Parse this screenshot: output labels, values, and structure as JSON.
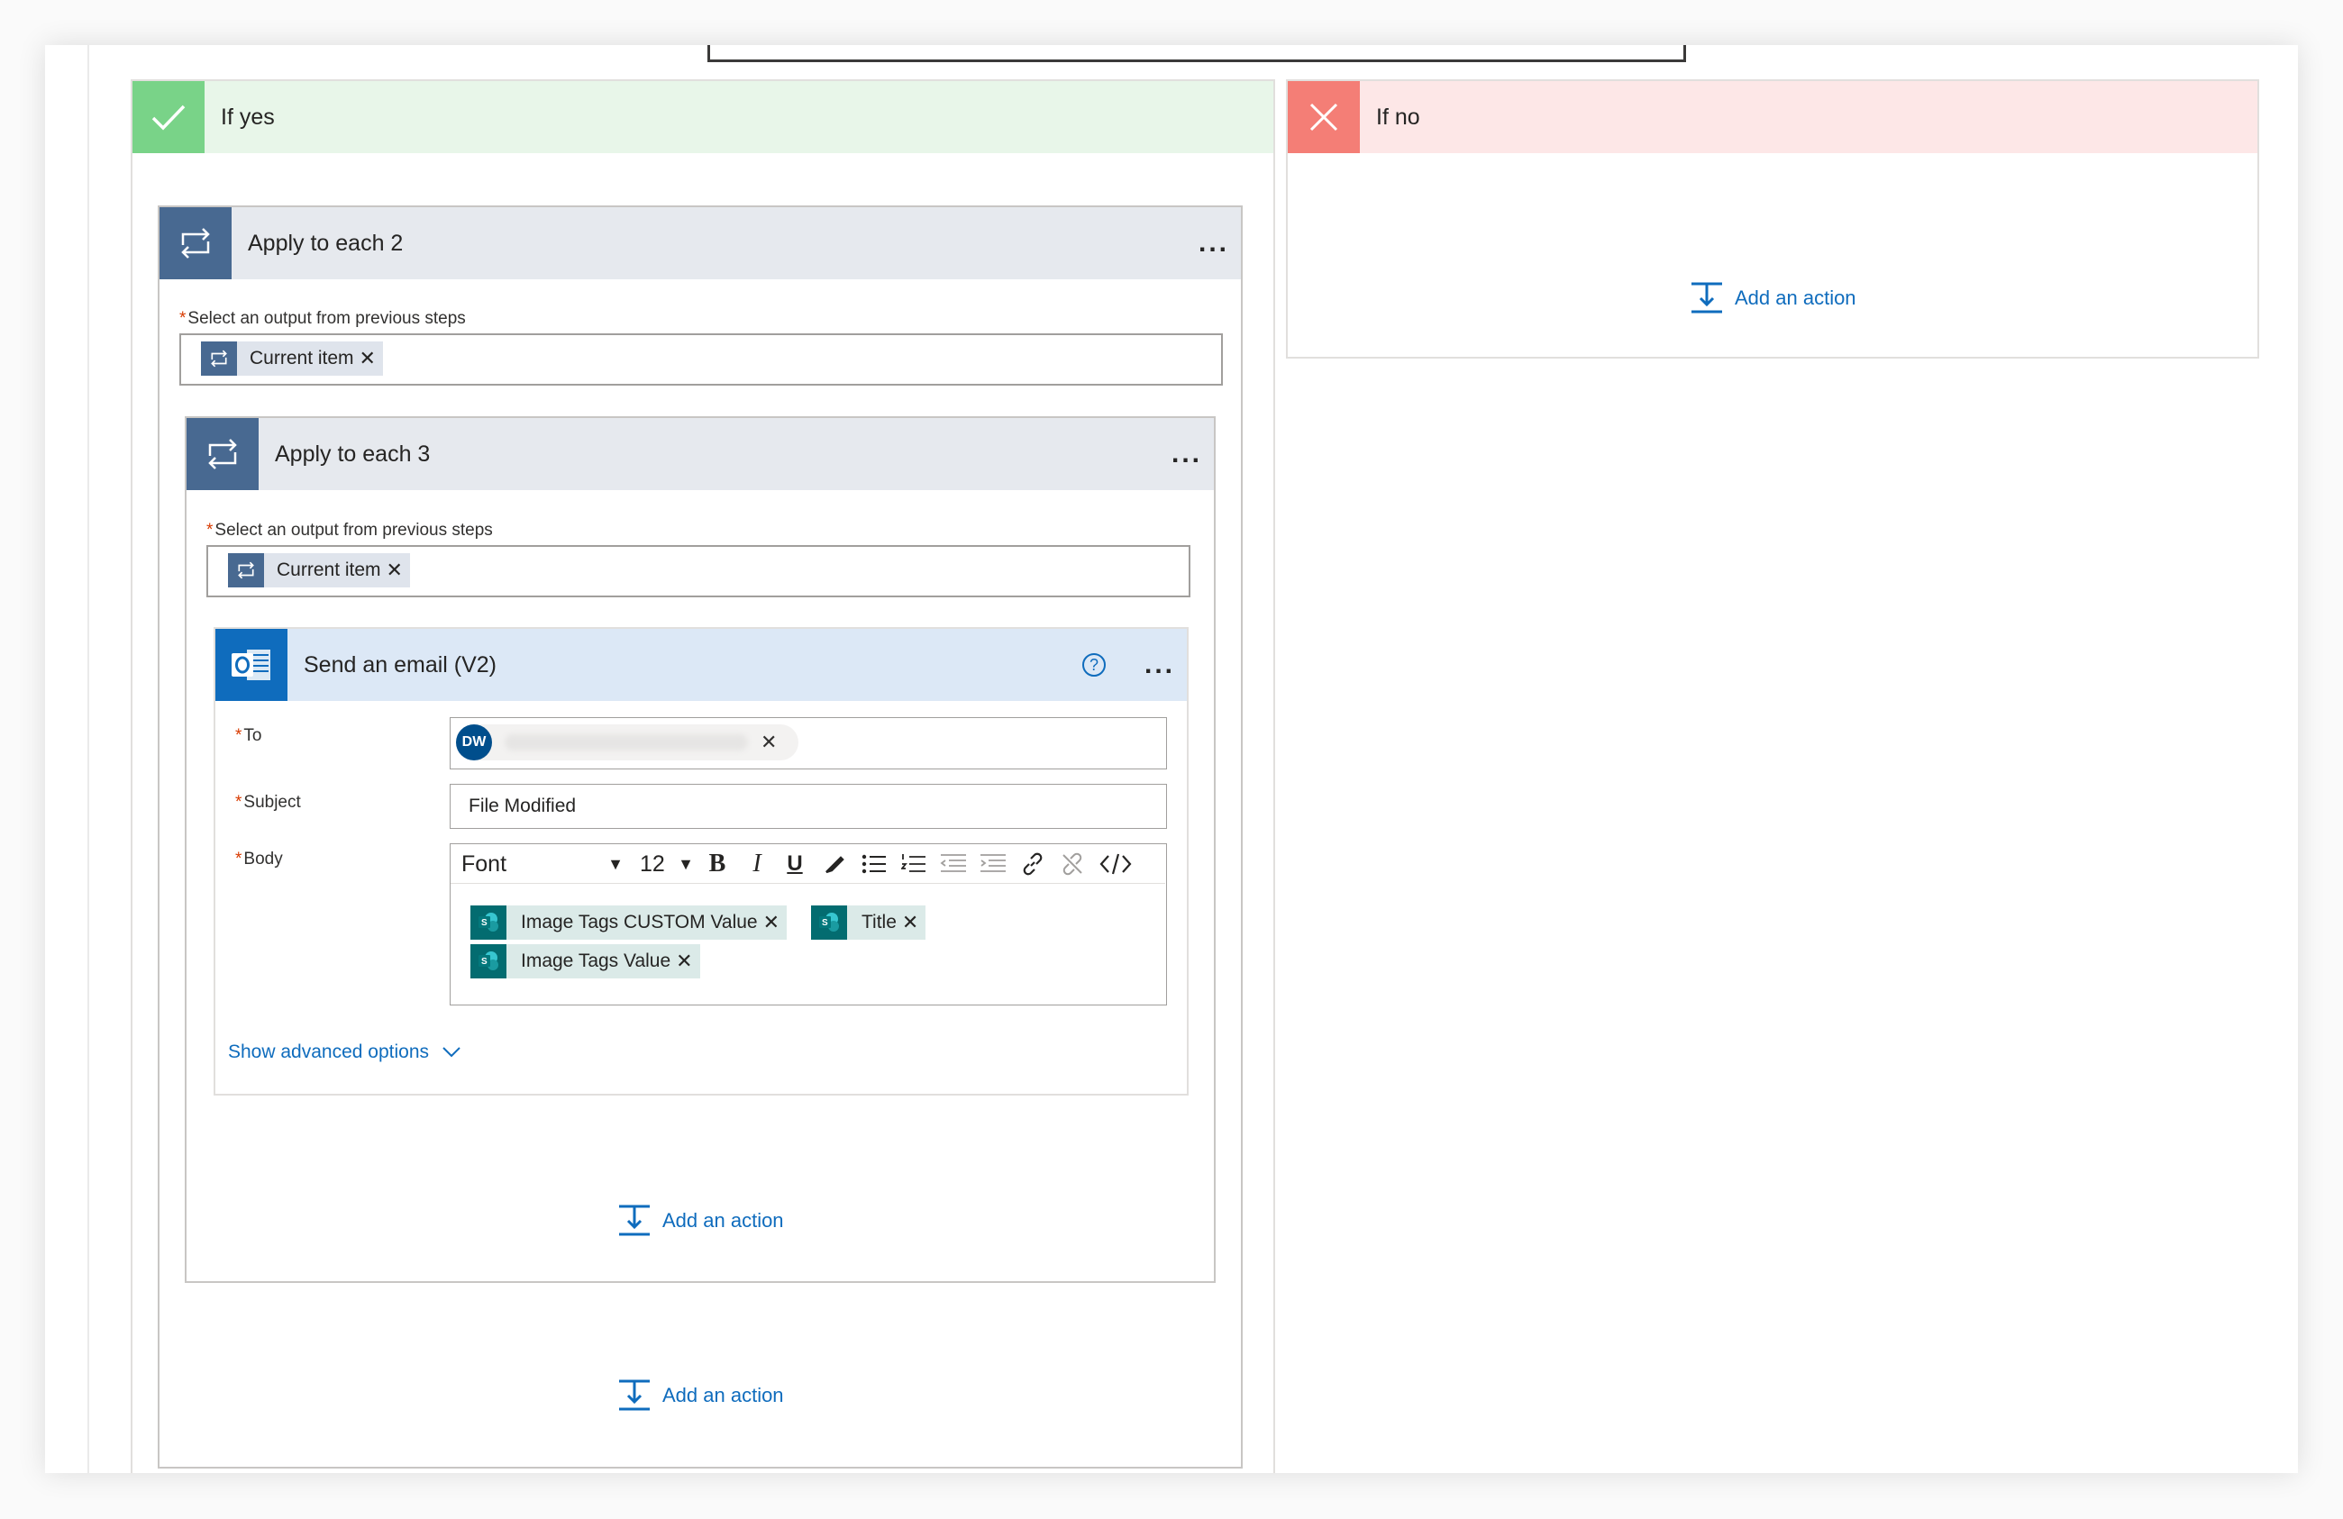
{
  "branches": {
    "yes": {
      "title": "If yes"
    },
    "no": {
      "title": "If no",
      "add_action": "Add an action"
    }
  },
  "apply2": {
    "title": "Apply to each 2",
    "more": "...",
    "select_label": "Select an output from previous steps",
    "token": "Current item"
  },
  "apply3": {
    "title": "Apply to each 3",
    "more": "...",
    "select_label": "Select an output from previous steps",
    "token": "Current item"
  },
  "email": {
    "title": "Send an email (V2)",
    "help": "?",
    "more": "...",
    "to_label": "To",
    "to_avatar": "DW",
    "subject_label": "Subject",
    "subject_value": "File Modified",
    "body_label": "Body",
    "font_select": "Font",
    "font_size": "12",
    "body_tokens": [
      "Image Tags CUSTOM Value",
      "Title",
      "Image Tags Value"
    ],
    "show_advanced": "Show advanced options"
  },
  "inner_add_action": "Add an action",
  "outer_add_action": "Add an action",
  "colors": {
    "yes_accent": "#79d388",
    "no_accent": "#f47e76",
    "loop_icon": "#486991",
    "outlook_icon": "#0f6cbd",
    "sharepoint_icon": "#036c70",
    "link": "#0f6cbd"
  }
}
